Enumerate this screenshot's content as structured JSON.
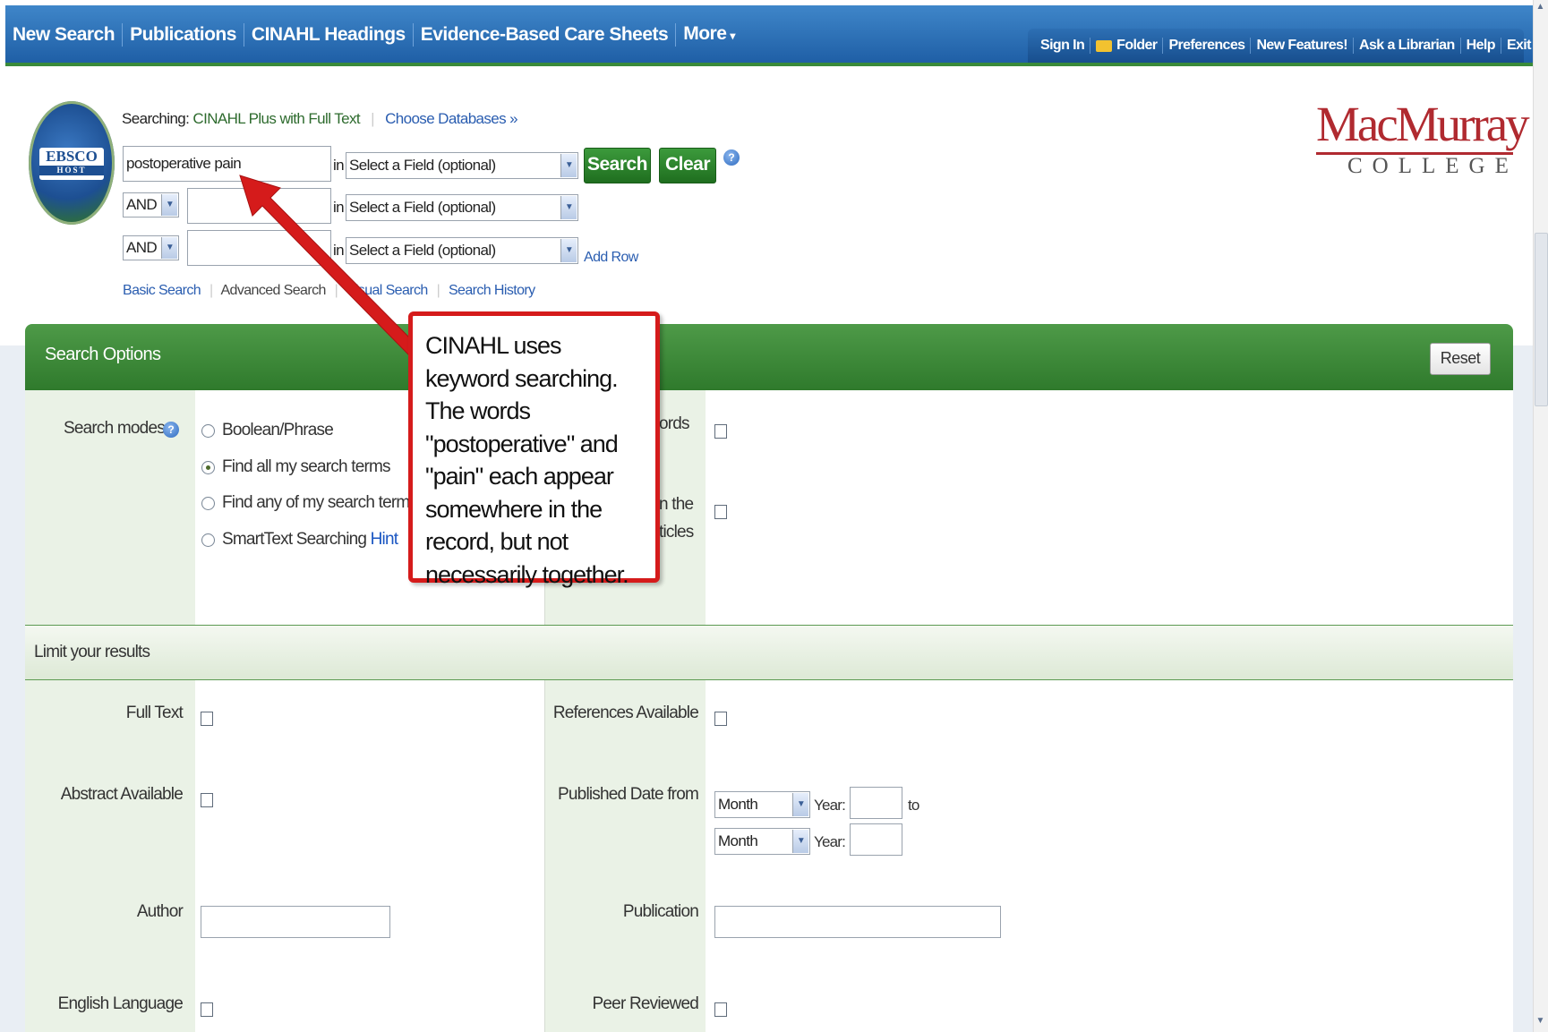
{
  "topnav": {
    "items": [
      {
        "label": "New Search"
      },
      {
        "label": "Publications"
      },
      {
        "label": "CINAHL Headings"
      },
      {
        "label": "Evidence-Based Care Sheets"
      },
      {
        "label": "More"
      }
    ]
  },
  "toolbar": {
    "items": [
      "Sign In",
      "Folder",
      "Preferences",
      "New Features!",
      "Ask a Librarian",
      "Help",
      "Exit"
    ]
  },
  "search": {
    "searching_label": "Searching:",
    "database": "CINAHL Plus with Full Text",
    "choose_databases": "Choose Databases »",
    "rows": [
      {
        "value": "postoperative pain",
        "field": "Select a Field (optional)"
      },
      {
        "operator": "AND",
        "value": "",
        "field": "Select a Field (optional)"
      },
      {
        "operator": "AND",
        "value": "",
        "field": "Select a Field (optional)"
      }
    ],
    "in_label": "in",
    "search_button": "Search",
    "clear_button": "Clear",
    "add_row": "Add Row",
    "links": [
      "Basic Search",
      "Advanced Search",
      "Visual Search",
      "Search History"
    ]
  },
  "college": {
    "name": "MacMurray",
    "sub": "COLLEGE"
  },
  "logo": {
    "top": "EBSCO",
    "bottom": "HOST"
  },
  "options": {
    "title": "Search Options",
    "reset": "Reset",
    "search_modes_label": "Search modes",
    "modes": [
      {
        "label": "Boolean/Phrase",
        "selected": false
      },
      {
        "label": "Find all my search terms",
        "selected": true
      },
      {
        "label": "Find any of my search terms",
        "selected": false
      },
      {
        "label": "SmartText Searching",
        "selected": false,
        "hint": "Hint"
      }
    ],
    "right_label_1": "ords",
    "right_label_2a": "n the",
    "right_label_2b": "ticles"
  },
  "limits": {
    "title": "Limit your results",
    "full_text": "Full Text",
    "references_available": "References Available",
    "abstract_available": "Abstract Available",
    "published_date_from": "Published Date from",
    "month": "Month",
    "year_label": "Year:",
    "to_label": "to",
    "author": "Author",
    "publication": "Publication",
    "english_language": "English Language",
    "peer_reviewed": "Peer Reviewed"
  },
  "callout": {
    "text": "CINAHL uses keyword searching.  The words \"postoperative\" and \"pain\" each appear somewhere in the record, but not necessarily together."
  },
  "colors": {
    "nav_blue": "#1f5fa6",
    "option_green": "#2f7a2c",
    "callout_red": "#d51b1b",
    "college_red": "#b02a30"
  }
}
